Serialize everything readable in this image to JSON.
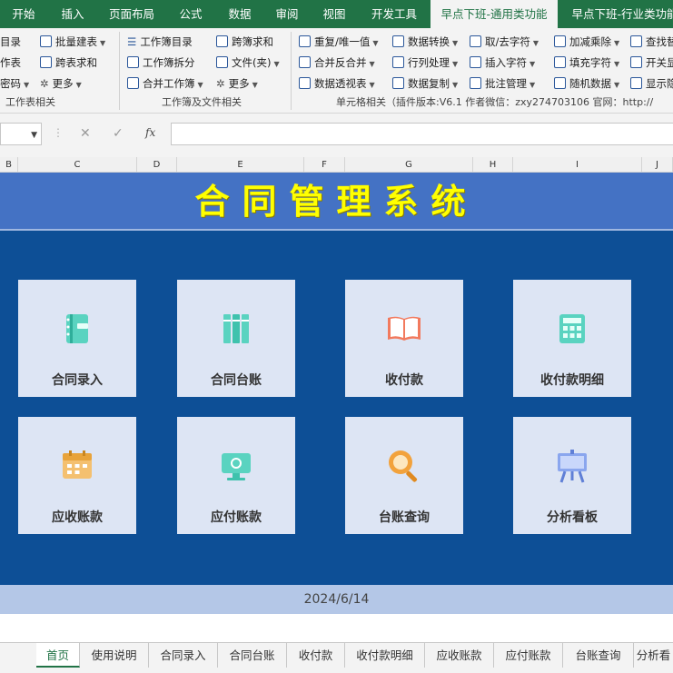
{
  "tabs": [
    "开始",
    "插入",
    "页面布局",
    "公式",
    "数据",
    "审阅",
    "视图",
    "开发工具",
    "早点下班-通用类功能",
    "早点下班-行业类功能"
  ],
  "active_tab": "早点下班-通用类功能",
  "ribbon": {
    "g1": [
      "目录",
      "作表",
      "密码"
    ],
    "g1_label": "工作表相关",
    "g2a": [
      "批量建表",
      "跨表求和",
      "更多"
    ],
    "g2b": [
      "工作簿目录",
      "工作簿拆分",
      "合并工作簿"
    ],
    "g2c": [
      "跨簿求和",
      "文件(夹)",
      "更多"
    ],
    "g2_label": "工作簿及文件相关",
    "g3a": [
      "重复/唯一值",
      "合并反合并",
      "数据透视表"
    ],
    "g3b": [
      "数据转换",
      "行列处理",
      "数据复制"
    ],
    "g3c": [
      "取/去字符",
      "插入字符",
      "批注管理"
    ],
    "g3d": [
      "加减乘除",
      "填充字符",
      "随机数据"
    ],
    "g3e": [
      "查找替",
      "开关显",
      "显示隐"
    ],
    "g3_label": "单元格相关（插件版本:V6.1 作者微信：zxy274703106 官网：http://"
  },
  "formula": {
    "fx": "fx",
    "cancel": "✕",
    "confirm": "✓"
  },
  "columns": [
    "B",
    "C",
    "D",
    "E",
    "F",
    "G",
    "H",
    "I",
    "J"
  ],
  "sheet": {
    "title": "合同管理系统",
    "tiles": [
      {
        "label": "合同录入",
        "icon": "notebook-icon"
      },
      {
        "label": "合同台账",
        "icon": "books-icon"
      },
      {
        "label": "收付款",
        "icon": "open-book-icon"
      },
      {
        "label": "收付款明细",
        "icon": "calculator-icon"
      },
      {
        "label": "应收账款",
        "icon": "calendar-icon"
      },
      {
        "label": "应付账款",
        "icon": "monitor-icon"
      },
      {
        "label": "台账查询",
        "icon": "magnifier-icon"
      },
      {
        "label": "分析看板",
        "icon": "easel-board-icon"
      }
    ],
    "date": "2024/6/14"
  },
  "sheet_tabs": [
    "首页",
    "使用说明",
    "合同录入",
    "合同台账",
    "收付款",
    "收付款明细",
    "应收账款",
    "应付账款",
    "台账查询",
    "分析看"
  ],
  "active_sheet": "首页",
  "colors": {
    "excel_green": "#217346",
    "sheet_bg": "#0d4f96",
    "title_bar": "#4472c4",
    "title_text": "#ffff00",
    "tile_bg": "#dde5f4"
  }
}
